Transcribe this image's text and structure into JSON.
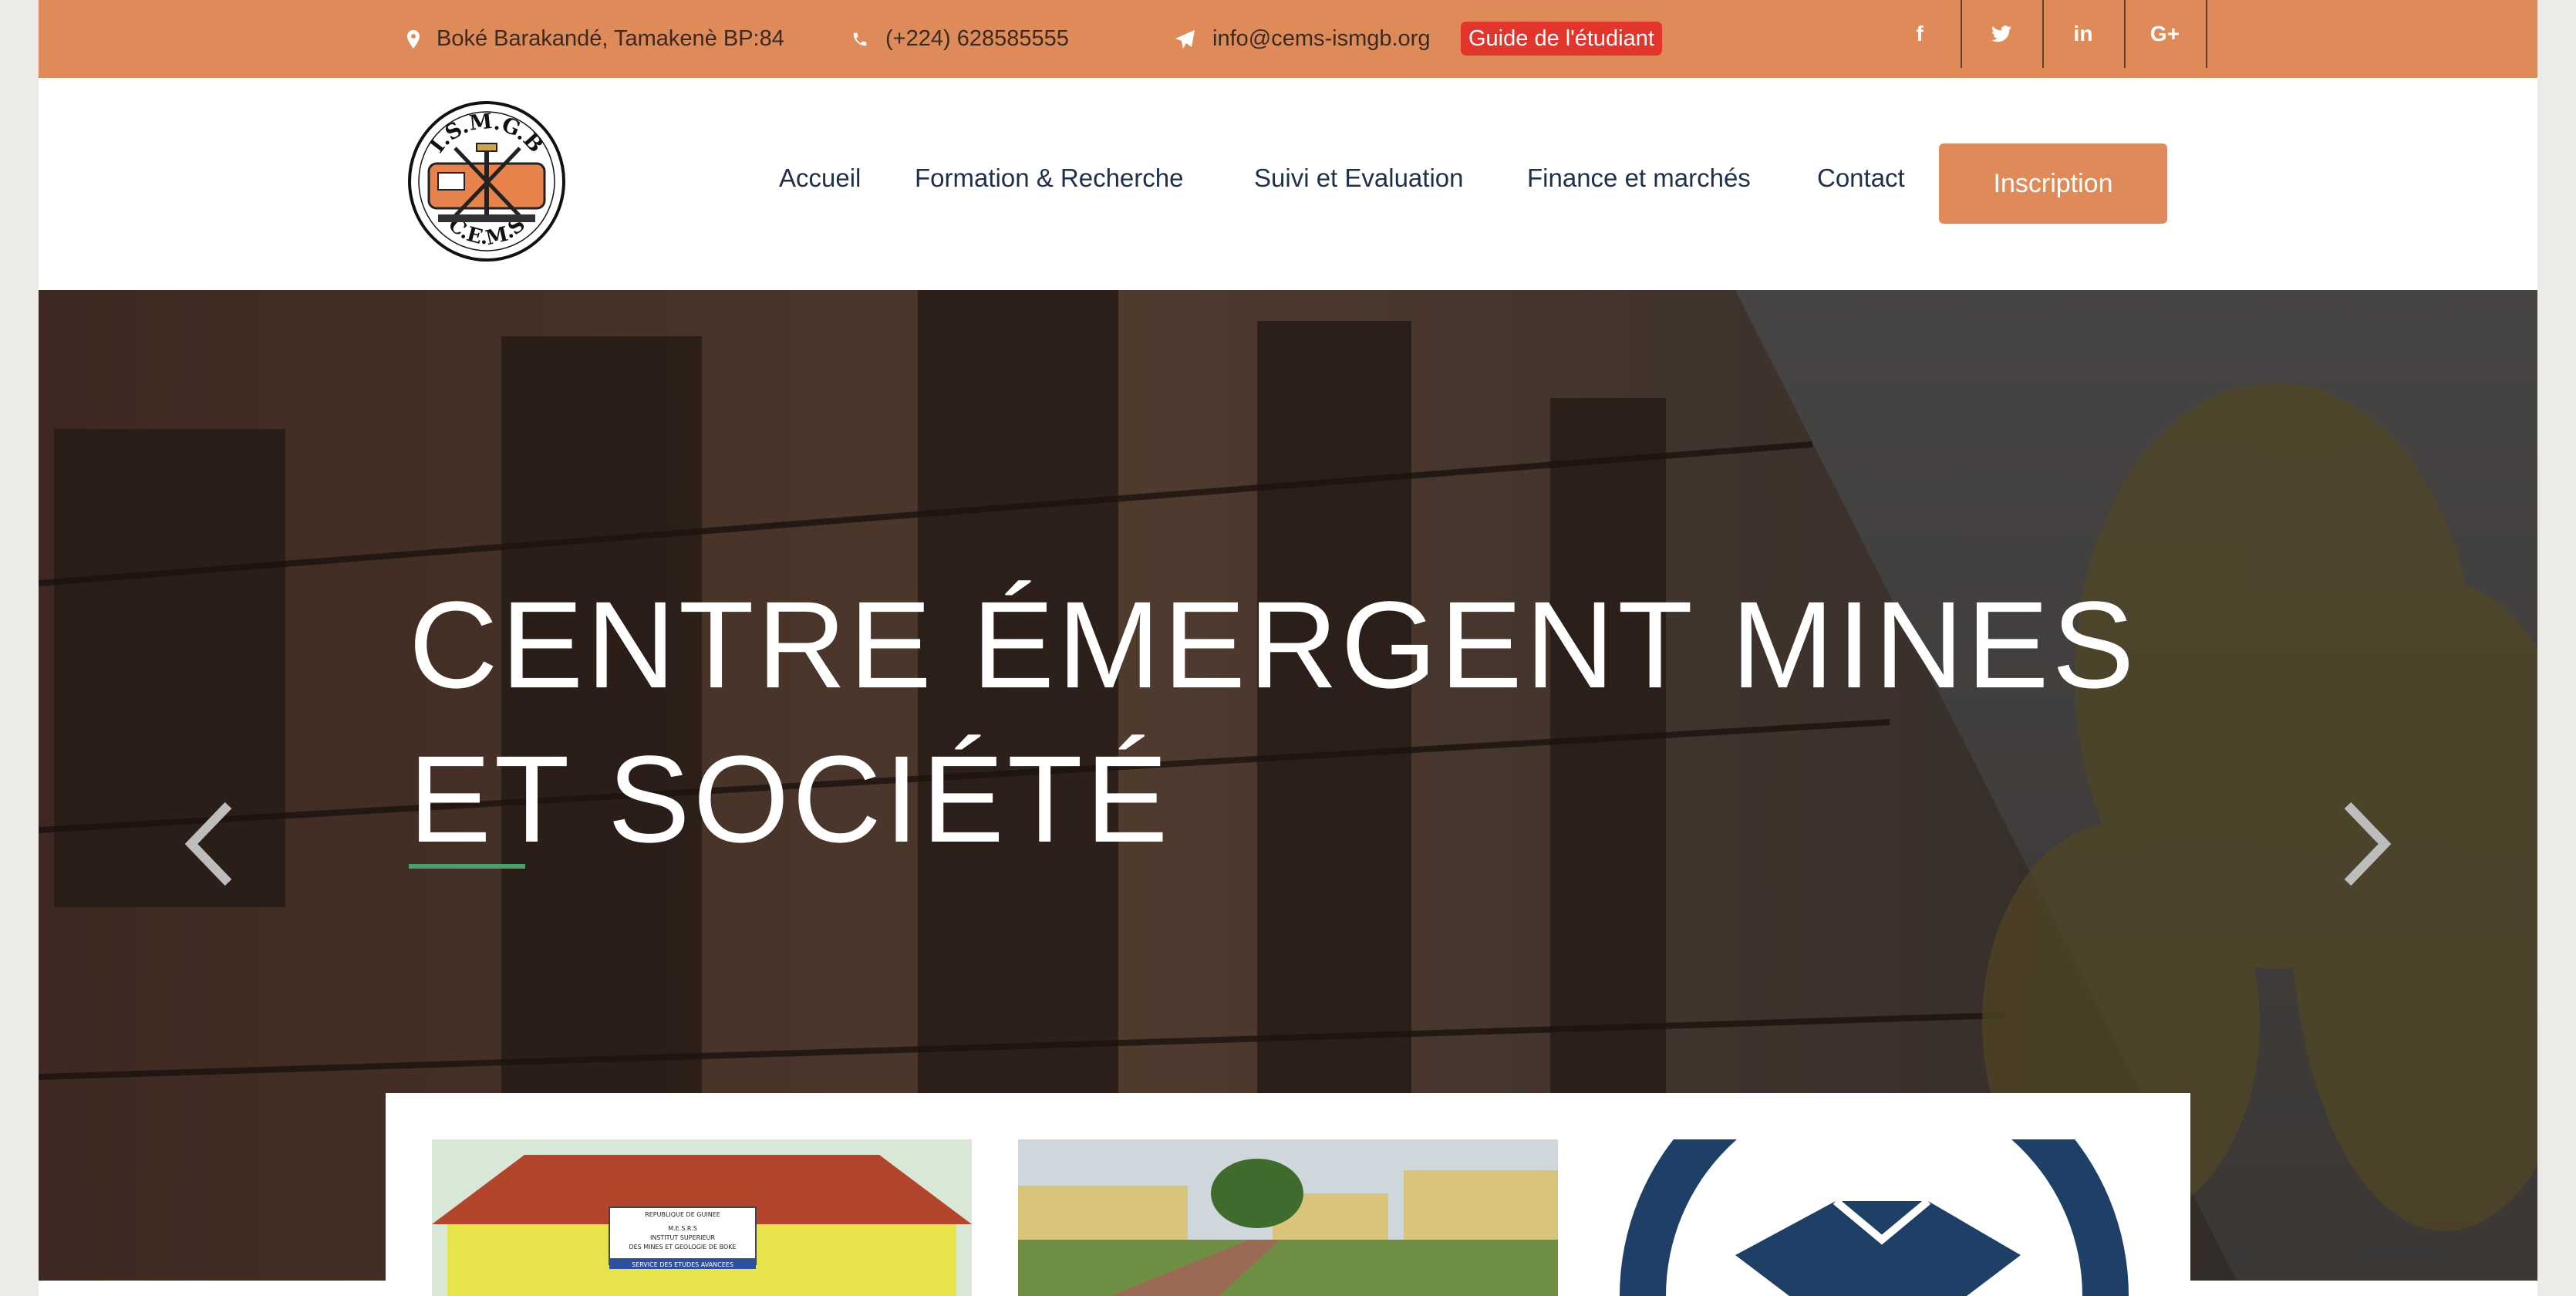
{
  "topbar": {
    "address": "Boké Barakandé, Tamakenè BP:84",
    "phone": "(+224) 628585555",
    "email": "info@cems-ismgb.org",
    "guide_label": "Guide de l'étudiant",
    "socials": [
      {
        "label": "f",
        "icon": "facebook-icon"
      },
      {
        "label": "twitter",
        "icon": "twitter-icon"
      },
      {
        "label": "in",
        "icon": "linkedin-icon"
      },
      {
        "label": "G+",
        "icon": "google-plus-icon"
      }
    ]
  },
  "header": {
    "logo": {
      "top_text": "I.S.M.G.B",
      "bottom_text": "C.E.M.S"
    },
    "nav": [
      "Accueil",
      "Formation & Recherche",
      "Suivi et Evaluation",
      "Finance et marchés",
      "Contact"
    ],
    "cta": "Inscription"
  },
  "hero": {
    "title_line1": "CENTRE ÉMERGENT MINES",
    "title_line2": "ET SOCIÉTÉ",
    "prev_icon": "chevron-left-icon",
    "next_icon": "chevron-right-icon"
  },
  "cards": {
    "sign_lines": [
      "REPUBLIQUE DE GUINEE",
      "M.E.S.R.S",
      "INSTITUT SUPERIEUR",
      "DES MINES ET GEOLOGIE DE BOKE",
      "SERVICE DES ETUDES AVANCEES"
    ]
  },
  "colors": {
    "topbar": "#df8a59",
    "badge": "#e2352b",
    "nav_text": "#1e3149",
    "accent_green": "#49a06b",
    "handshake_blue": "#1e3f66"
  }
}
